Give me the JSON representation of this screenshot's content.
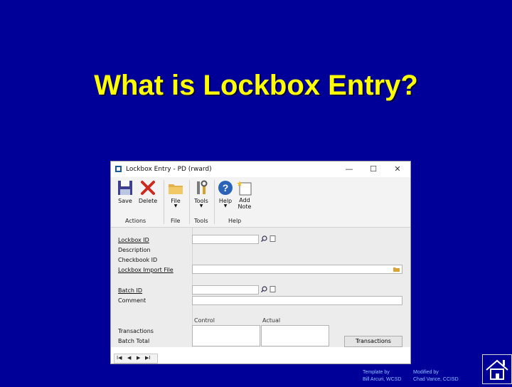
{
  "slide": {
    "title": "What is Lockbox Entry?"
  },
  "window": {
    "title": "Lockbox Entry  -  PD (rward)",
    "minimize": "—",
    "maximize": "☐",
    "close": "✕"
  },
  "ribbon": {
    "buttons": [
      {
        "label": "Save",
        "icon": "save-icon"
      },
      {
        "label": "Delete",
        "icon": "delete-icon"
      },
      {
        "label": "File",
        "icon": "folder-icon",
        "caret": "▼"
      },
      {
        "label": "Tools",
        "icon": "tools-icon",
        "caret": "▼"
      },
      {
        "label": "Help",
        "icon": "help-icon",
        "caret": "▼"
      },
      {
        "label1": "Add",
        "label2": "Note",
        "icon": "add-note-icon"
      }
    ],
    "groups": [
      "Actions",
      "File",
      "Tools",
      "Help"
    ]
  },
  "form": {
    "lockbox_id_label": "Lockbox ID",
    "description_label": "Description",
    "checkbook_id_label": "Checkbook ID",
    "import_file_label": "Lockbox Import File",
    "batch_id_label": "Batch ID",
    "comment_label": "Comment",
    "control_header": "Control",
    "actual_header": "Actual",
    "transactions_label": "Transactions",
    "batch_total_label": "Batch Total",
    "transactions_button": "Transactions"
  },
  "nav": {
    "first": "I◀",
    "prev": "◀",
    "next": "▶",
    "last": "▶I"
  },
  "footer": {
    "template_by": "Template by",
    "template_author": "Bill Arcuri, WCSD",
    "modified_by": "Modified by",
    "modified_author": "Chad Vance, CCISD"
  },
  "colors": {
    "background": "#000099",
    "title": "#ffff00"
  }
}
